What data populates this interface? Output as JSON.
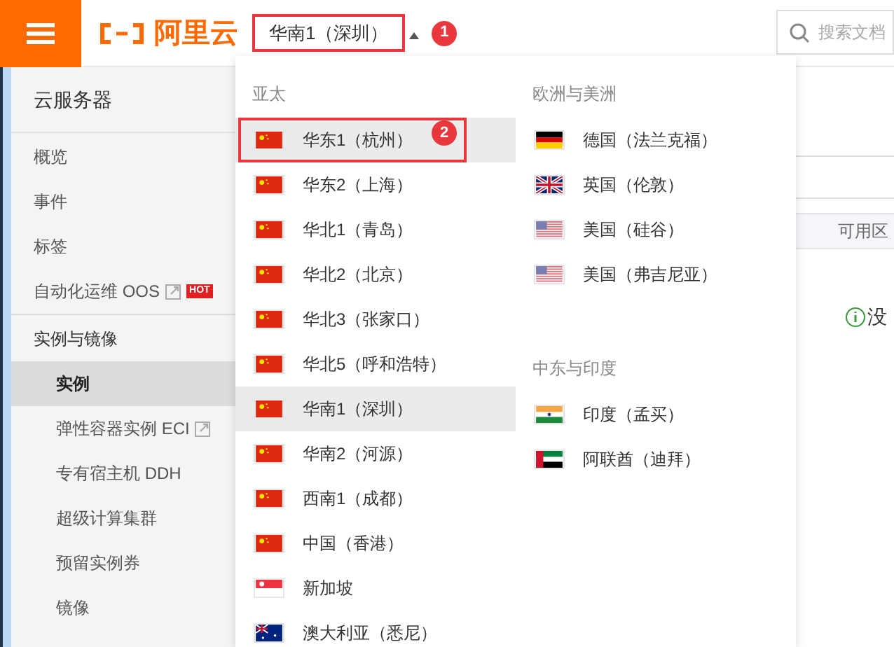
{
  "header": {
    "logo_text": "阿里云",
    "region_selector": {
      "label": "华南1（深圳）",
      "outlined": true,
      "badge": "1"
    },
    "search": {
      "placeholder": "搜索文档"
    }
  },
  "sidebar": {
    "title": "云服务器",
    "groups": [
      {
        "items": [
          {
            "label": "概览",
            "selected": false
          },
          {
            "label": "事件",
            "selected": false
          },
          {
            "label": "标签",
            "selected": false
          },
          {
            "label": "自动化运维 OOS",
            "selected": false,
            "external": true,
            "tag": "HOT"
          }
        ]
      },
      {
        "title": "实例与镜像",
        "items": [
          {
            "label": "实例",
            "selected": true
          },
          {
            "label": "弹性容器实例 ECI",
            "selected": false,
            "external": true
          },
          {
            "label": "专有宿主机 DDH",
            "selected": false
          },
          {
            "label": "超级计算集群",
            "selected": false
          },
          {
            "label": "预留实例券",
            "selected": false
          },
          {
            "label": "镜像",
            "selected": false
          }
        ]
      }
    ]
  },
  "content": {
    "column_header": "可用区",
    "notice": "没"
  },
  "region_menu": {
    "columns": [
      {
        "groups": [
          {
            "title": "亚太",
            "regions": [
              {
                "label": "华东1（杭州）",
                "kind": "cn",
                "highlighted": true,
                "outlined": true,
                "badge": "2"
              },
              {
                "label": "华东2（上海）",
                "kind": "cn",
                "highlighted": false
              },
              {
                "label": "华北1（青岛）",
                "kind": "cn",
                "highlighted": false
              },
              {
                "label": "华北2（北京）",
                "kind": "cn",
                "highlighted": false
              },
              {
                "label": "华北3（张家口）",
                "kind": "cn",
                "highlighted": false
              },
              {
                "label": "华北5（呼和浩特）",
                "kind": "cn",
                "highlighted": false
              },
              {
                "label": "华南1（深圳）",
                "kind": "cn",
                "highlighted": true
              },
              {
                "label": "华南2（河源）",
                "kind": "cn",
                "highlighted": false
              },
              {
                "label": "西南1（成都）",
                "kind": "cn",
                "highlighted": false
              },
              {
                "label": "中国（香港）",
                "kind": "cn",
                "highlighted": false
              },
              {
                "label": "新加坡",
                "kind": "sg",
                "highlighted": false
              },
              {
                "label": "澳大利亚（悉尼）",
                "kind": "au",
                "highlighted": false
              }
            ]
          }
        ]
      },
      {
        "groups": [
          {
            "title": "欧洲与美洲",
            "regions": [
              {
                "label": "德国（法兰克福）",
                "kind": "de",
                "highlighted": false
              },
              {
                "label": "英国（伦敦）",
                "kind": "gb",
                "highlighted": false
              },
              {
                "label": "美国（硅谷）",
                "kind": "us",
                "highlighted": false
              },
              {
                "label": "美国（弗吉尼亚）",
                "kind": "us",
                "highlighted": false
              }
            ]
          },
          {
            "title": "中东与印度",
            "regions": [
              {
                "label": "印度（孟买）",
                "kind": "in",
                "highlighted": false
              },
              {
                "label": "阿联酋（迪拜）",
                "kind": "ae",
                "highlighted": false
              }
            ]
          }
        ]
      }
    ]
  }
}
